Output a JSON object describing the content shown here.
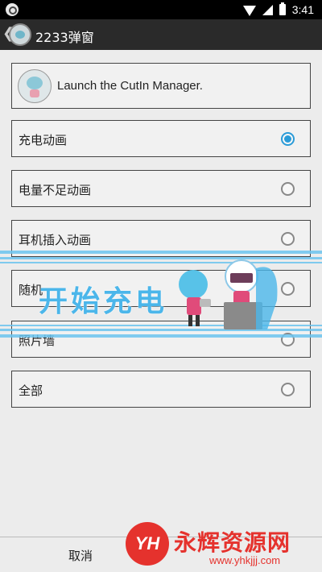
{
  "status_bar": {
    "time": "3:41",
    "icons": [
      "app-icon",
      "wifi-icon",
      "signal-icon",
      "battery-icon"
    ]
  },
  "action_bar": {
    "back_glyph": "❮",
    "title": "2233弹窗"
  },
  "header": {
    "text": "Launch the CutIn Manager."
  },
  "options": [
    {
      "label": "充电动画",
      "selected": true
    },
    {
      "label": "电量不足动画",
      "selected": false
    },
    {
      "label": "耳机插入动画",
      "selected": false
    },
    {
      "label": "随机",
      "selected": false
    },
    {
      "label": "照片墙",
      "selected": false
    },
    {
      "label": "全部",
      "selected": false
    }
  ],
  "bottom": {
    "cancel_label": "取消"
  },
  "overlay": {
    "text": "开始充电"
  },
  "watermark": {
    "logo": "YH",
    "title": "永辉资源网",
    "url": "www.yhkjjj.com"
  },
  "colors": {
    "accent": "#2a9bd8",
    "overlay_blue": "#4bb6ea",
    "watermark_red": "#e5322d"
  }
}
